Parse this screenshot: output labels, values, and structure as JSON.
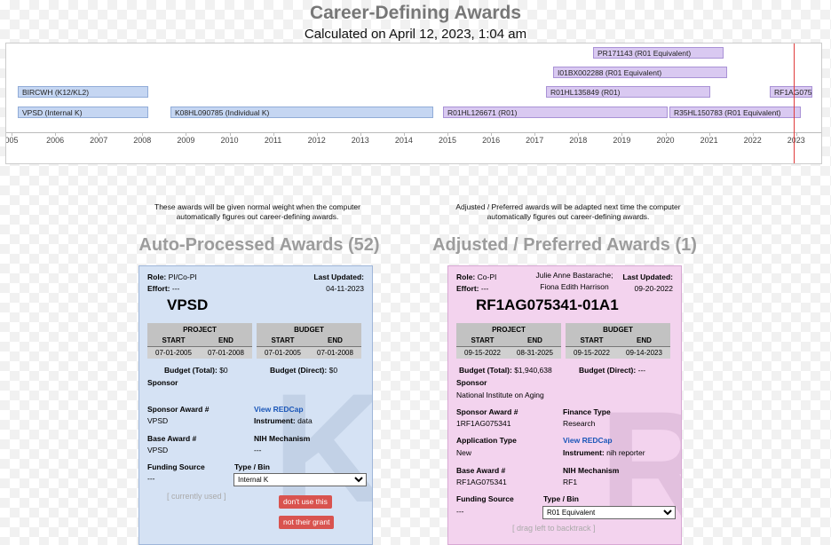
{
  "title": "Career-Defining Awards",
  "subtitle": "Calculated on April 12, 2023, 1:04 am",
  "timeline": {
    "years": [
      "005",
      "2006",
      "2007",
      "2008",
      "2009",
      "2010",
      "2011",
      "2012",
      "2013",
      "2014",
      "2015",
      "2016",
      "2017",
      "2018",
      "2019",
      "2020",
      "2021",
      "2022",
      "2023"
    ],
    "bars": [
      {
        "label": "PR171143 (R01 Equivalent)",
        "kind": "r"
      },
      {
        "label": "I01BX002288 (R01 Equivalent)",
        "kind": "r"
      },
      {
        "label": "BIRCWH (K12/KL2)",
        "kind": "k"
      },
      {
        "label": "R01HL135849 (R01)",
        "kind": "r"
      },
      {
        "label": "RF1AG075",
        "kind": "r"
      },
      {
        "label": "VPSD (Internal K)",
        "kind": "k"
      },
      {
        "label": "K08HL090785 (Individual K)",
        "kind": "k"
      },
      {
        "label": "R01HL126671 (R01)",
        "kind": "r"
      },
      {
        "label": "R35HL150783 (R01 Equivalent)",
        "kind": "r"
      }
    ]
  },
  "auto": {
    "note": "These awards will be given normal weight when the computer automatically figures out career-defining awards.",
    "heading": "Auto-Processed Awards (52)",
    "card": {
      "role_label": "Role:",
      "role": "PI/Co-PI",
      "effort_label": "Effort:",
      "effort": "---",
      "updated_label": "Last Updated:",
      "updated": "04-11-2023",
      "name": "VPSD",
      "project_label": "PROJECT",
      "budget_label": "BUDGET",
      "start_label": "START",
      "end_label": "END",
      "project_start": "07-01-2005",
      "project_end": "07-01-2008",
      "budget_start": "07-01-2005",
      "budget_end": "07-01-2008",
      "budget_total_label": "Budget (Total):",
      "budget_total": "$0",
      "budget_direct_label": "Budget (Direct):",
      "budget_direct": "$0",
      "sponsor_label": "Sponsor",
      "sponsor_award_label": "Sponsor Award #",
      "sponsor_award": "VPSD",
      "view_redcap": "View REDCap",
      "instrument_label": "Instrument:",
      "instrument": "data",
      "base_award_label": "Base Award #",
      "base_award": "VPSD",
      "nih_label": "NIH Mechanism",
      "nih": "---",
      "funding_label": "Funding Source",
      "funding": "---",
      "type_label": "Type / Bin",
      "type_value": "Internal K",
      "status": "[ currently used ]",
      "btn_dont": "don't use this",
      "btn_not": "not their grant",
      "watermark": "K"
    }
  },
  "adjusted": {
    "note": "Adjusted / Preferred awards will be adapted next time the computer automatically figures out career-defining awards.",
    "heading": "Adjusted / Preferred Awards (1)",
    "card": {
      "role_label": "Role:",
      "role": "Co-PI",
      "effort_label": "Effort:",
      "effort": "---",
      "people_1": "Julie Anne Bastarache;",
      "people_2": "Fiona Edith Harrison",
      "updated_label": "Last Updated:",
      "updated": "09-20-2022",
      "name": "RF1AG075341-01A1",
      "project_label": "PROJECT",
      "budget_label": "BUDGET",
      "start_label": "START",
      "end_label": "END",
      "project_start": "09-15-2022",
      "project_end": "08-31-2025",
      "budget_start": "09-15-2022",
      "budget_end": "09-14-2023",
      "budget_total_label": "Budget (Total):",
      "budget_total": "$1,940,638",
      "budget_direct_label": "Budget (Direct):",
      "budget_direct": "---",
      "sponsor_label": "Sponsor",
      "sponsor": "National Institute on Aging",
      "sponsor_award_label": "Sponsor Award #",
      "sponsor_award": "1RF1AG075341",
      "finance_label": "Finance Type",
      "finance": "Research",
      "app_type_label": "Application Type",
      "app_type": "New",
      "view_redcap": "View REDCap",
      "instrument_label": "Instrument:",
      "instrument": "nih reporter",
      "base_award_label": "Base Award #",
      "base_award": "RF1AG075341",
      "nih_label": "NIH Mechanism",
      "nih": "RF1",
      "funding_label": "Funding Source",
      "funding": "---",
      "type_label": "Type / Bin",
      "type_value": "R01 Equivalent",
      "hint": "[ drag left to backtrack ]",
      "watermark": "R"
    }
  }
}
